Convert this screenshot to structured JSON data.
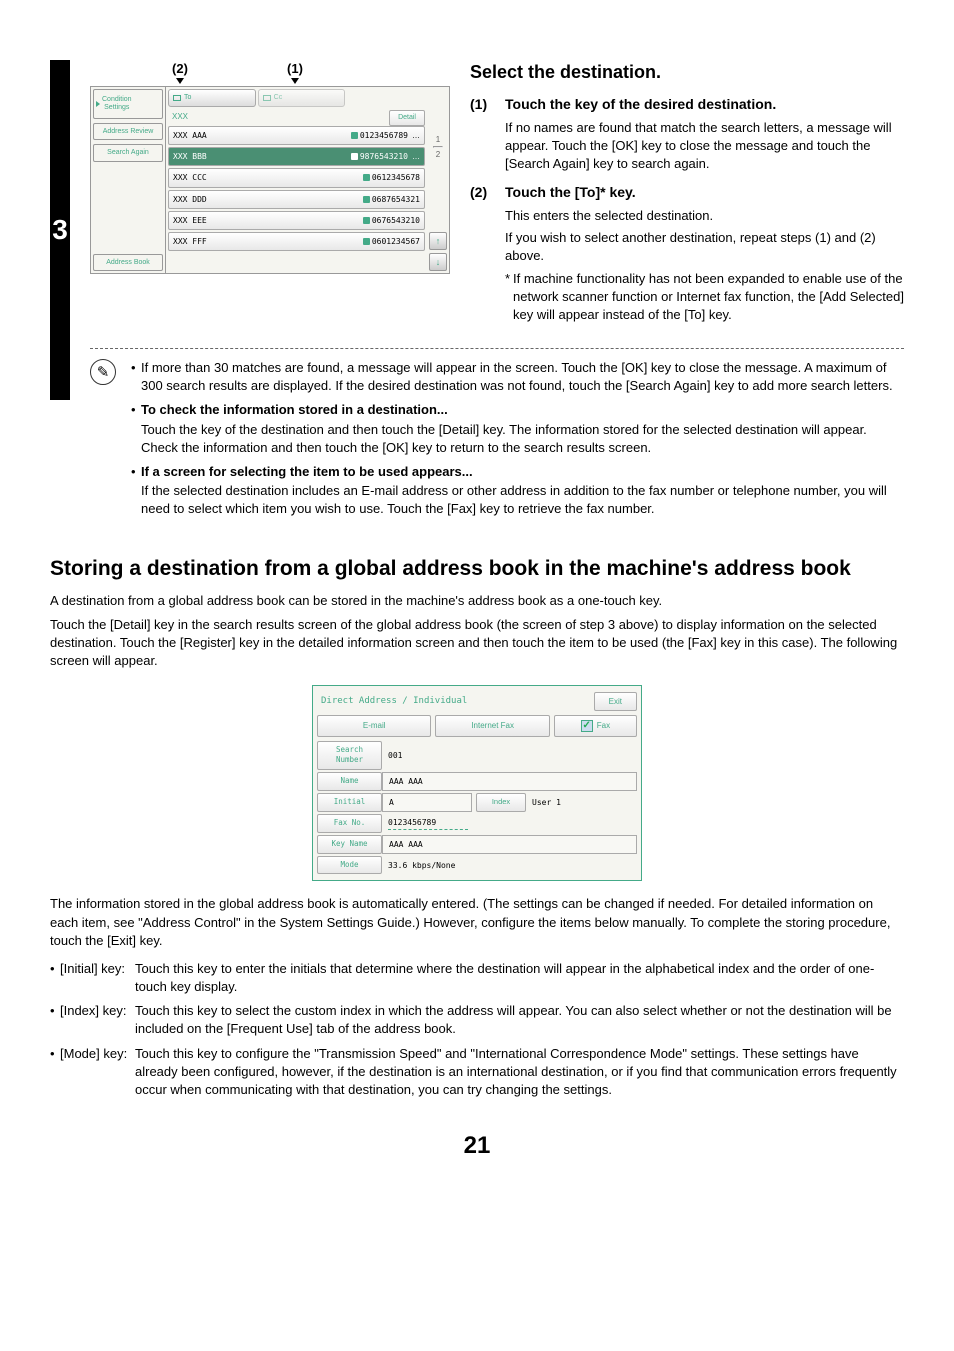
{
  "side_tab": "3",
  "markers": {
    "m1": "(1)",
    "m2": "(2)"
  },
  "panel": {
    "left_items": {
      "condition": "Condition\nSettings",
      "address_review": "Address Review",
      "search_again": "Search Again",
      "address_book": "Address Book"
    },
    "header": {
      "to": "To",
      "cc": "Cc",
      "search_txt": "XXX",
      "detail": "Detail"
    },
    "rows": [
      {
        "name": "XXX AAA",
        "num": "0123456789",
        "sel": false,
        "ell": true
      },
      {
        "name": "XXX BBB",
        "num": "9876543210",
        "sel": true,
        "ell": true
      },
      {
        "name": "XXX CCC",
        "num": "0612345678",
        "sel": false,
        "ell": false
      },
      {
        "name": "XXX DDD",
        "num": "0687654321",
        "sel": false,
        "ell": false
      },
      {
        "name": "XXX EEE",
        "num": "0676543210",
        "sel": false,
        "ell": false
      },
      {
        "name": "XXX FFF",
        "num": "0601234567",
        "sel": false,
        "ell": false
      }
    ],
    "pager_top": "1",
    "pager_bot": "2"
  },
  "right": {
    "heading": "Select the destination.",
    "s1_num": "(1)",
    "s1_title": "Touch the key of the desired destination.",
    "s1_body": "If no names are found that match the search letters, a message will appear. Touch the [OK] key to close the message and touch the [Search Again] key to search again.",
    "s2_num": "(2)",
    "s2_title": "Touch the [To]* key.",
    "s2_body_a": "This enters the selected destination.",
    "s2_body_b": "If you wish to select another destination, repeat steps (1) and (2) above.",
    "s2_note_star": "*",
    "s2_note": "If machine functionality has not been expanded to enable use of the network scanner function or Internet fax function, the [Add Selected] key will appear instead of the [To] key."
  },
  "tips": {
    "icon": "✎",
    "t1": "If more than 30 matches are found, a message will appear in the screen. Touch the [OK] key to close the message. A maximum of 300 search results are displayed. If the desired destination was not found, touch the [Search Again] key to add more search letters.",
    "t2_title": "To check the information stored in a destination...",
    "t2": "Touch the key of the destination and then touch the [Detail] key. The information stored for the selected destination will appear. Check the information and then touch the [OK] key to return to the search results screen.",
    "t3_title": "If a screen for selecting the item to be used appears...",
    "t3": "If the selected destination includes an E-mail address or other address in addition to the fax number or telephone number, you will need to select which item you wish to use. Touch the [Fax] key to retrieve the fax number."
  },
  "h_storing": "Storing a destination from a global address book in the machine's address book",
  "para1": "A destination from a global address book can be stored in the machine's address book as a one-touch key.",
  "para2": "Touch the [Detail] key in the search results screen of the global address book (the screen of step 3 above) to display information on the selected destination. Touch the [Register] key in the detailed information screen and then touch the item to be used (the [Fax] key in this case). The following screen will appear.",
  "dialog": {
    "title": "Direct Address / Individual",
    "exit": "Exit",
    "tabs": {
      "email": "E-mail",
      "ifax": "Internet Fax",
      "fax": "Fax",
      "check": "✓"
    },
    "rows": {
      "search_number_lbl": "Search Number",
      "search_number_val": "001",
      "name_lbl": "Name",
      "name_val": "AAA AAA",
      "initial_lbl": "Initial",
      "initial_val": "A",
      "index_lbl": "Index",
      "index_val": "User 1",
      "faxno_lbl": "Fax No.",
      "faxno_val": "0123456789",
      "keyname_lbl": "Key Name",
      "keyname_val": "AAA AAA",
      "mode_lbl": "Mode",
      "mode_val": "33.6 kbps/None"
    }
  },
  "para3": "The information stored in the global address book is automatically entered. (The settings can be changed if needed. For detailed information on each item, see \"Address Control\" in the System Settings Guide.) However, configure the items below manually. To complete the storing procedure, touch the [Exit] key.",
  "config": {
    "initial_lbl": "[Initial] key:",
    "initial_txt": "Touch this key to enter the initials that determine where the destination will appear in the alphabetical index and the order of one-touch key display.",
    "index_lbl": "[Index] key:",
    "index_txt": "Touch this key to select the custom index in which the address will appear. You can also select whether or not the destination will be included on the [Frequent Use] tab of the address book.",
    "mode_lbl": "[Mode] key:",
    "mode_txt": "Touch this key to configure the \"Transmission Speed\" and \"International Correspondence Mode\" settings. These settings have already been configured, however, if the destination is an international destination, or if you find that communication errors frequently occur when communicating with that destination, you can try changing the settings."
  },
  "page_num": "21"
}
